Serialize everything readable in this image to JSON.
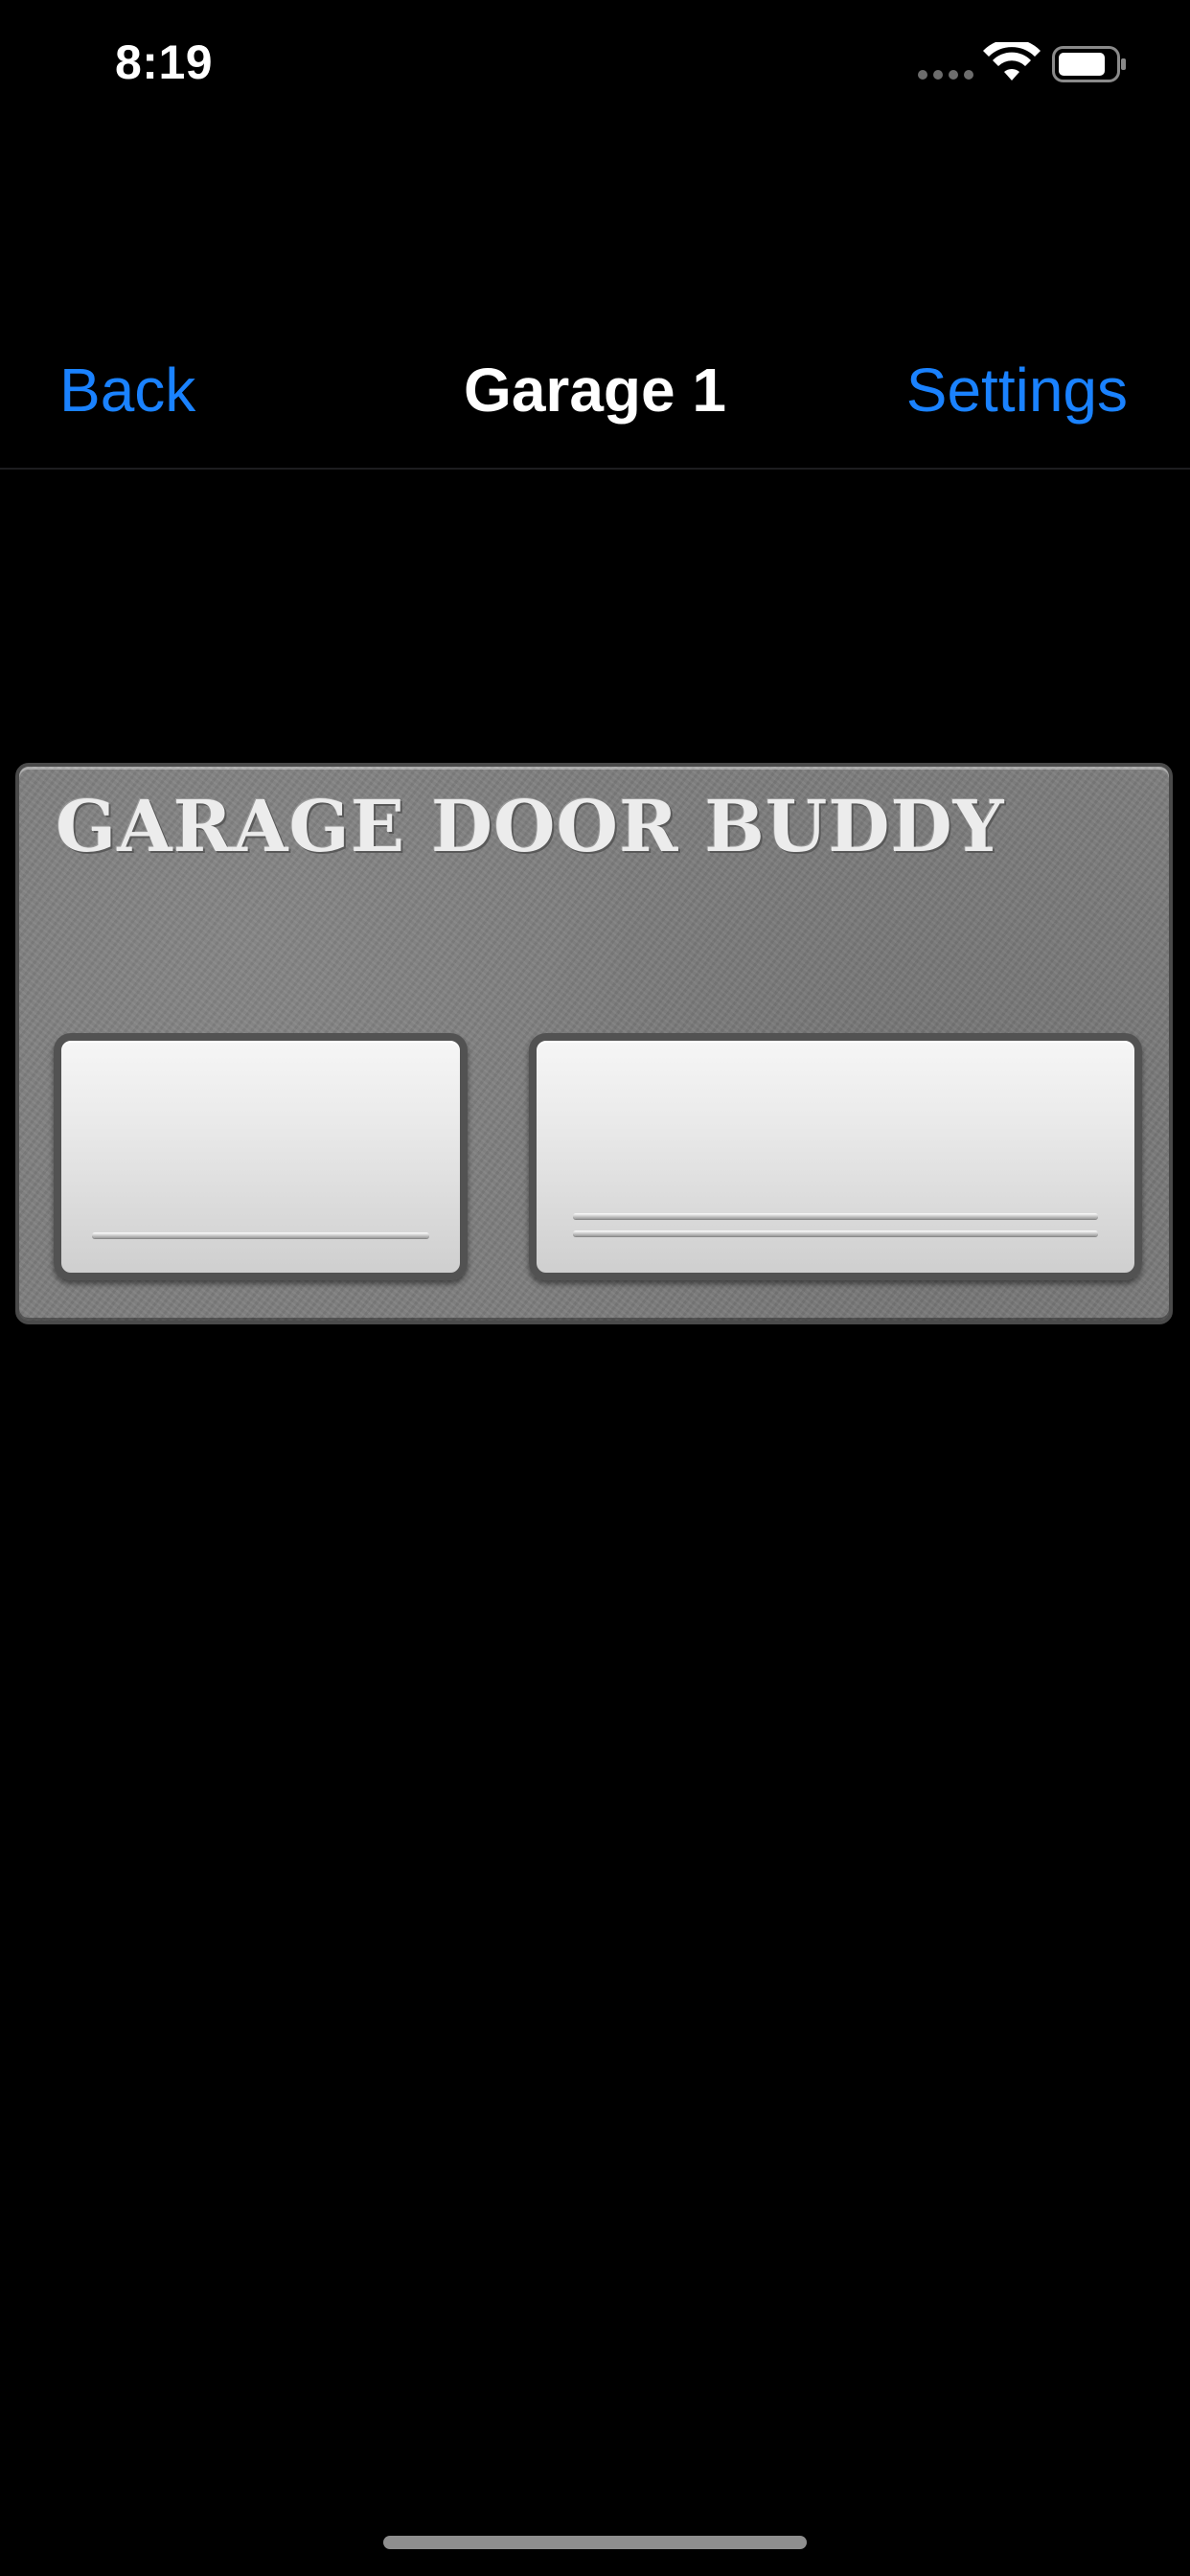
{
  "status_bar": {
    "time": "8:19",
    "icons": [
      "signal-dots-icon",
      "wifi-icon",
      "battery-icon"
    ]
  },
  "nav": {
    "back_label": "Back",
    "title": "Garage 1",
    "settings_label": "Settings"
  },
  "remote": {
    "brand": "GARAGE DOOR BUDDY",
    "buttons": [
      {
        "name": "garage-door-button-1",
        "bars": 1
      },
      {
        "name": "garage-door-button-2",
        "bars": 2
      }
    ]
  },
  "colors": {
    "background": "#000000",
    "accent": "#1a82ff",
    "title": "#ffffff",
    "panel": "#7e7e7e",
    "button": "#e8e8e8"
  }
}
